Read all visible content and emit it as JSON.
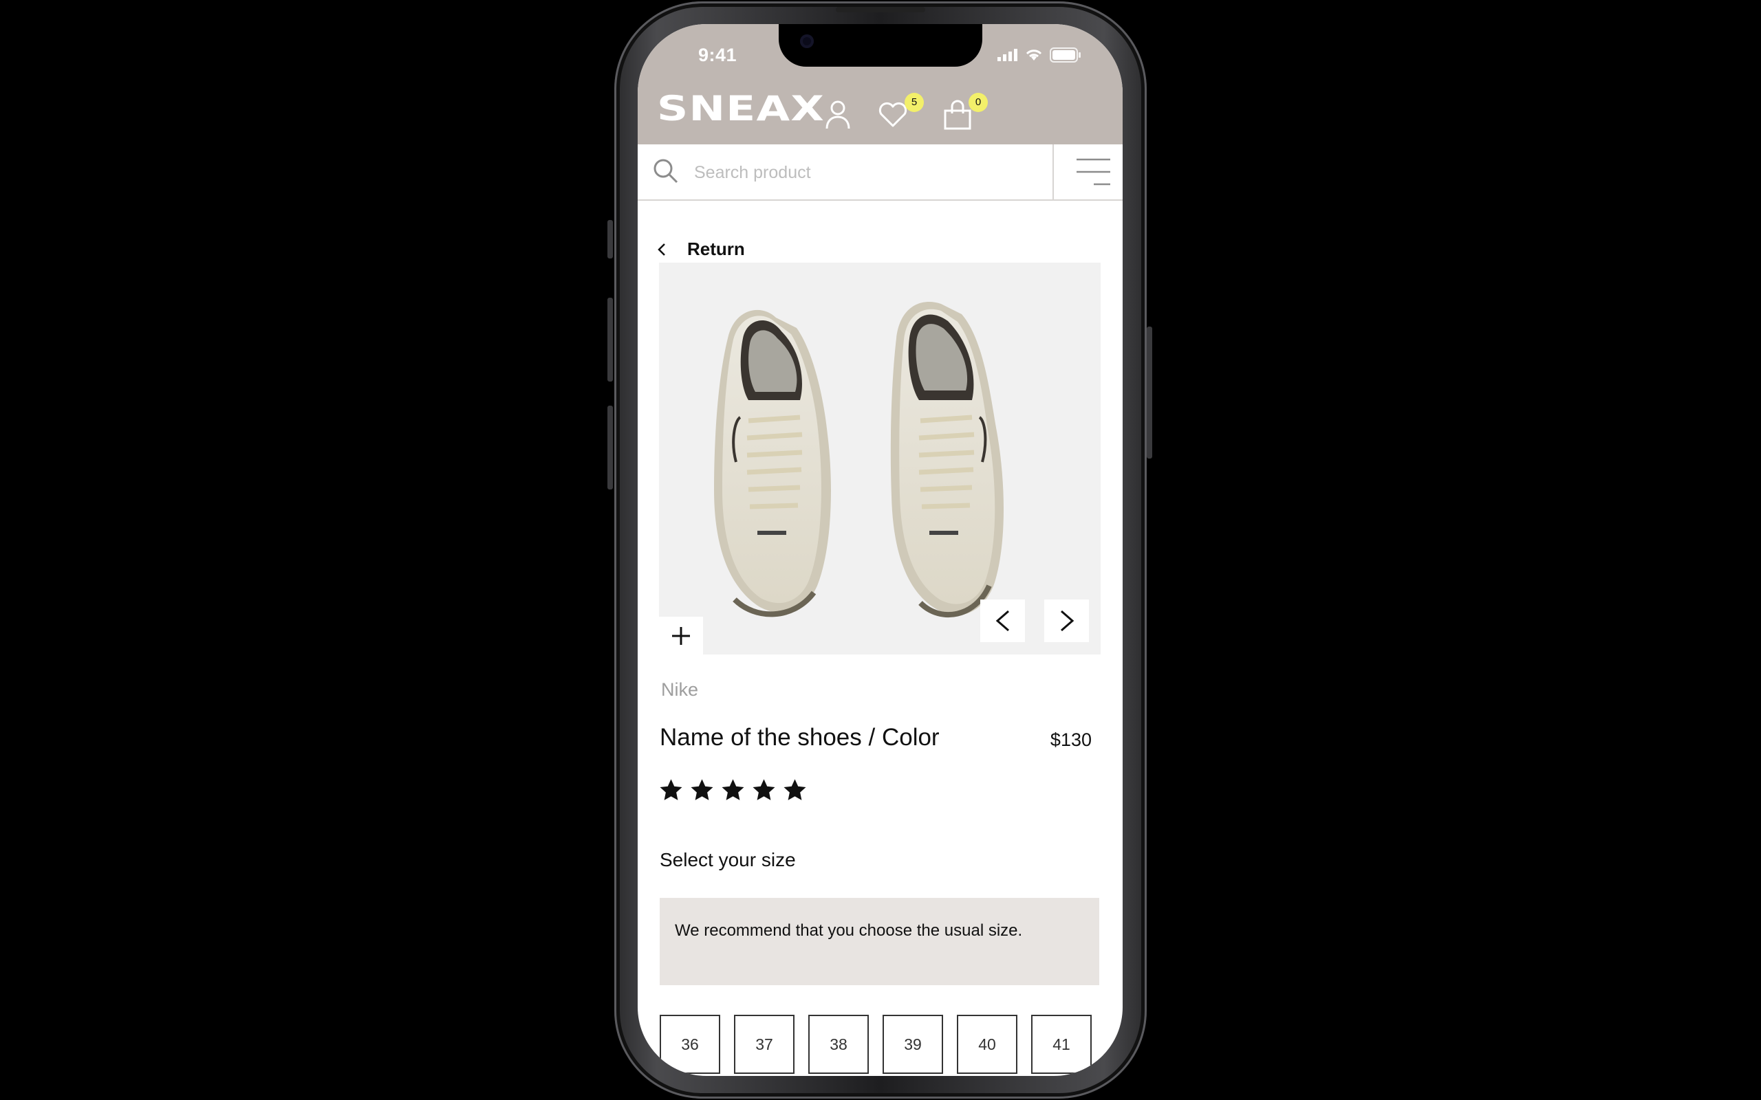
{
  "status_bar": {
    "time": "9:41"
  },
  "header": {
    "logo_text": "SNEAX",
    "wishlist_count": "5",
    "cart_count": "0",
    "background_color": "#bfb7b2",
    "badge_color": "#f3f06a"
  },
  "search": {
    "placeholder": "Search product"
  },
  "nav": {
    "return_label": "Return"
  },
  "product": {
    "brand": "Nike",
    "name": "Name of the shoes / Color",
    "price": "$130",
    "rating": 5,
    "rating_max": 5
  },
  "size_section": {
    "title": "Select your size",
    "recommendation": "We recommend that you choose the usual size.",
    "sizes": [
      "36",
      "37",
      "38",
      "39",
      "40",
      "41"
    ]
  },
  "icons": {
    "user": "user-icon",
    "wishlist": "heart-icon",
    "cart": "shopping-bag-icon",
    "search": "search-icon",
    "menu": "hamburger-menu-icon",
    "back": "chevron-left-icon",
    "zoom": "plus-icon",
    "prev_image": "chevron-left-icon",
    "next_image": "chevron-right-icon",
    "star": "star-icon"
  }
}
